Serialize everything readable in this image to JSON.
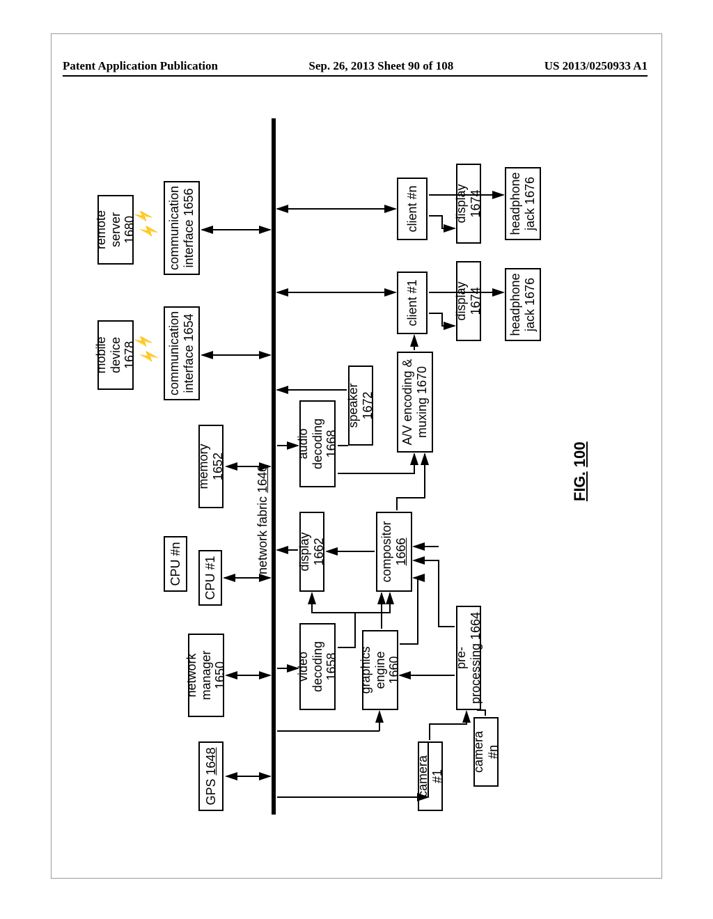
{
  "header": {
    "left": "Patent Application Publication",
    "center": "Sep. 26, 2013  Sheet 90 of 108",
    "right": "US 2013/0250933 A1"
  },
  "bus": {
    "label": "network fabric",
    "ref": "1646"
  },
  "figure": {
    "prefix": "FIG.",
    "num": "100"
  },
  "boxes": {
    "gps": {
      "label": "GPS",
      "ref": "1648"
    },
    "netmgr": {
      "label": "network\nmanager",
      "ref": "1650"
    },
    "cpu1": {
      "label": "CPU #1",
      "ref": ""
    },
    "cpun": {
      "label": "CPU #n",
      "ref": ""
    },
    "memory": {
      "label": "memory",
      "ref": "1652"
    },
    "comm1": {
      "label": "communication\ninterface",
      "ref": "1654"
    },
    "comm2": {
      "label": "communication\ninterface",
      "ref": "1656"
    },
    "mobile": {
      "label": "mobile\ndevice",
      "ref": "1678"
    },
    "remote": {
      "label": "remote\nserver",
      "ref": "1680"
    },
    "vdec": {
      "label": "video\ndecoding",
      "ref": "1658"
    },
    "graphics": {
      "label": "graphics\nengine",
      "ref": "1660"
    },
    "display": {
      "label": "display",
      "ref": "1662"
    },
    "compositor": {
      "label": "compositor",
      "ref": "1666"
    },
    "preproc": {
      "label": "pre-\nprocessing",
      "ref": "1664"
    },
    "adec": {
      "label": "audio\ndecoding",
      "ref": "1668"
    },
    "speaker": {
      "label": "speaker",
      "ref": "1672"
    },
    "avmux": {
      "label": "A/V encoding &\nmuxing",
      "ref": "1670"
    },
    "cam1": {
      "label": "camera #1",
      "ref": ""
    },
    "camn": {
      "label": "camera #n",
      "ref": ""
    },
    "client1": {
      "label": "client #1",
      "ref": ""
    },
    "clientn": {
      "label": "client #n",
      "ref": ""
    },
    "disp1": {
      "label": "display",
      "ref": "1674"
    },
    "dispn": {
      "label": "display",
      "ref": "1674"
    },
    "hp1": {
      "label": "headphone\njack",
      "ref": "1676"
    },
    "hpn": {
      "label": "headphone\njack",
      "ref": "1676"
    }
  }
}
